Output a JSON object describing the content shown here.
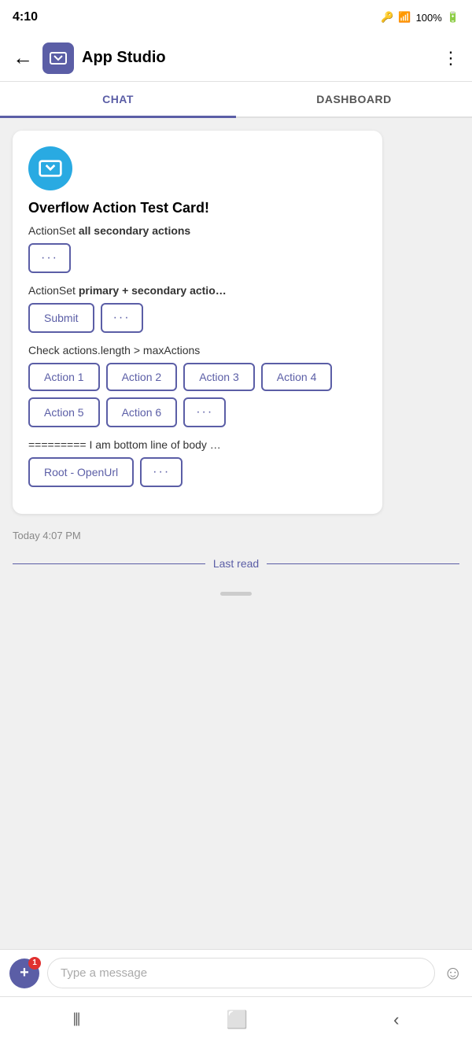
{
  "statusBar": {
    "time": "4:10",
    "battery": "100%"
  },
  "nav": {
    "title": "App Studio",
    "backLabel": "←",
    "moreLabel": "⋮"
  },
  "tabs": [
    {
      "id": "chat",
      "label": "CHAT",
      "active": true
    },
    {
      "id": "dashboard",
      "label": "DASHBOARD",
      "active": false
    }
  ],
  "card": {
    "title": "Overflow Action Test Card!",
    "section1": {
      "label": "ActionSet",
      "labelBold": "all secondary actions",
      "buttons": [
        {
          "id": "overflow1",
          "text": "···",
          "type": "overflow"
        }
      ]
    },
    "section2": {
      "label": "ActionSet",
      "labelBold": "primary + secondary actio…",
      "buttons": [
        {
          "id": "submit",
          "text": "Submit",
          "type": "action"
        },
        {
          "id": "overflow2",
          "text": "···",
          "type": "overflow"
        }
      ]
    },
    "section3": {
      "label": "Check actions.length > maxActions",
      "buttons": [
        {
          "id": "action1",
          "text": "Action 1",
          "type": "action"
        },
        {
          "id": "action2",
          "text": "Action 2",
          "type": "action"
        },
        {
          "id": "action3",
          "text": "Action 3",
          "type": "action"
        },
        {
          "id": "action4",
          "text": "Action 4",
          "type": "action"
        },
        {
          "id": "action5",
          "text": "Action 5",
          "type": "action"
        },
        {
          "id": "action6",
          "text": "Action 6",
          "type": "action"
        },
        {
          "id": "overflow3",
          "text": "···",
          "type": "overflow"
        }
      ]
    },
    "section4": {
      "label": "========= I am bottom line of body …",
      "buttons": [
        {
          "id": "rootOpenUrl",
          "text": "Root - OpenUrl",
          "type": "action"
        },
        {
          "id": "overflow4",
          "text": "···",
          "type": "overflow"
        }
      ]
    }
  },
  "timestamp": "Today 4:07 PM",
  "lastRead": "Last read",
  "input": {
    "placeholder": "Type a message",
    "attachBadge": "1"
  }
}
